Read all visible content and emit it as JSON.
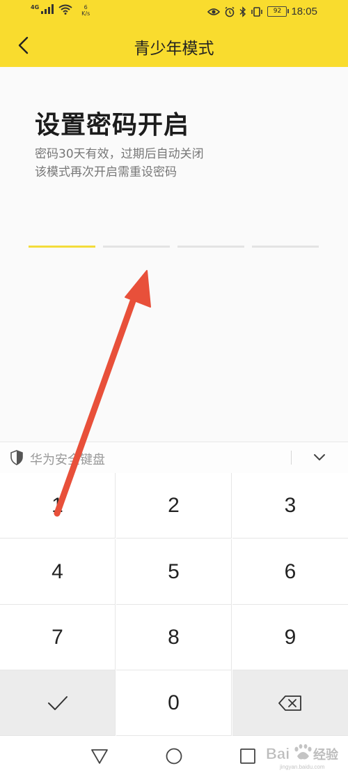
{
  "status_bar": {
    "network": "4G",
    "speed_value": "6",
    "speed_unit": "K/s",
    "battery": "92",
    "time": "18:05"
  },
  "header": {
    "title": "青少年模式"
  },
  "main": {
    "heading": "设置密码开启",
    "desc_line1": "密码30天有效，过期后自动关闭",
    "desc_line2": "该模式再次开启需重设密码",
    "pin_length": 4,
    "pin_filled": 0
  },
  "keyboard": {
    "title": "华为安全键盘",
    "keys": [
      "1",
      "2",
      "3",
      "4",
      "5",
      "6",
      "7",
      "8",
      "9",
      "0"
    ]
  },
  "colors": {
    "header_bg": "#f9dc2e",
    "pin_active": "#f3dc3a",
    "annotation_arrow": "#e8503a"
  },
  "watermark": {
    "text": "Bai经验",
    "subtext": "jingyan.baidu.com"
  }
}
